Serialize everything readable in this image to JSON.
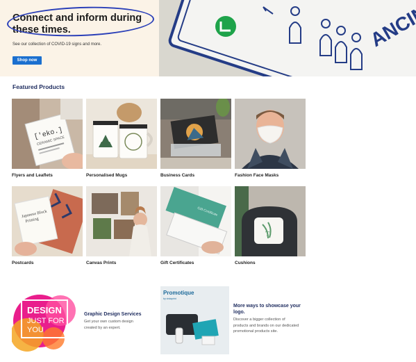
{
  "hero": {
    "title": "Connect and inform during these times.",
    "subtitle": "See our collection of COVID-19 signs and more.",
    "button_label": "Shop now",
    "sign_text": "ANCING"
  },
  "featured": {
    "title": "Featured Products",
    "products": [
      {
        "label": "Flyers and Leaflets"
      },
      {
        "label": "Personalised Mugs"
      },
      {
        "label": "Business Cards"
      },
      {
        "label": "Fashion Face Masks"
      },
      {
        "label": "Postcards"
      },
      {
        "label": "Canvas Prints"
      },
      {
        "label": "Gift Certificates"
      },
      {
        "label": "Cushions"
      }
    ]
  },
  "promos": {
    "design": {
      "image_line1": "DESIGN",
      "image_line2": "JUST FOR",
      "image_line3": "YOU",
      "title": "Graphic Design Services",
      "text": "Get your own custom design created by an expert."
    },
    "promotique": {
      "brand": "Promotique",
      "brand_sub": "by vistaprint",
      "title": "More ways to showcase your logo.",
      "text": "Discover a bigger collection of products and brands on our dedicated promotional products site."
    }
  },
  "colors": {
    "accent": "#1a6fcf",
    "heading": "#1d2b5e",
    "circle_annotation": "#2a3fb8"
  }
}
